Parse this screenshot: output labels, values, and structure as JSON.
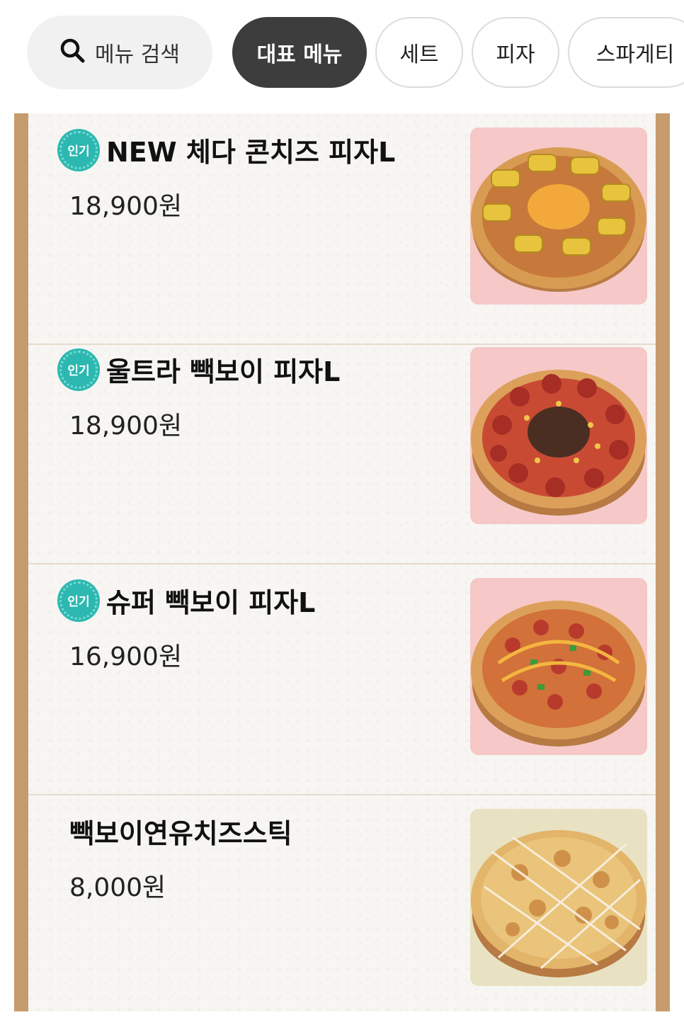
{
  "search": {
    "label": "메뉴 검색",
    "icon": "search-icon"
  },
  "categories": [
    {
      "label": "대표 메뉴",
      "active": true
    },
    {
      "label": "세트",
      "active": false
    },
    {
      "label": "피자",
      "active": false
    },
    {
      "label": "스파게티",
      "active": false
    }
  ],
  "items": [
    {
      "badge": "인기",
      "name": "NEW 체다 콘치즈 피자L",
      "price": "18,900원",
      "image": "cheddar-corn-cheese-pizza",
      "bg": "#f6c8c8"
    },
    {
      "badge": "인기",
      "name": "울트라 빽보이 피자L",
      "price": "18,900원",
      "image": "ultra-paikboy-pizza",
      "bg": "#f6c8c8"
    },
    {
      "badge": "인기",
      "name": "슈퍼 빽보이 피자L",
      "price": "16,900원",
      "image": "super-paikboy-pizza",
      "bg": "#f6c8c8"
    },
    {
      "badge": "",
      "name": "빽보이연유치즈스틱",
      "price": "8,000원",
      "image": "condensed-milk-cheese-stick",
      "bg": "#e8e2c3"
    }
  ],
  "colors": {
    "active_chip": "#3d3d3d",
    "badge": "#2cb8b0",
    "frame": "#c69b6d"
  }
}
